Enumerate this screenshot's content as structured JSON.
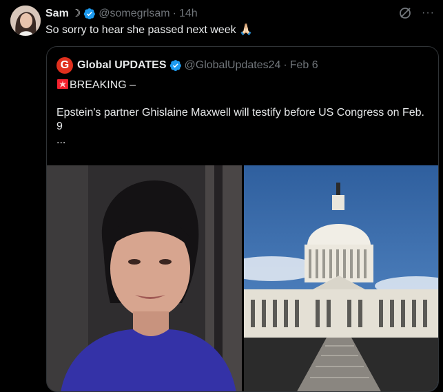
{
  "author": {
    "name": "Sam",
    "moon": "☽",
    "handle": "@somegrlsam",
    "separator": "·",
    "time": "14h"
  },
  "tweet": {
    "text": "So sorry to hear she passed next week",
    "emoji": "🙏🏻"
  },
  "header_icons": {
    "grok": "grok-icon",
    "more": "more-icon",
    "more_text": "···"
  },
  "quoted": {
    "logo_letter": "G",
    "name": "Global UPDATES",
    "handle": "@GlobalUpdates24",
    "separator": "·",
    "date": "Feb 6",
    "line1": "BREAKING –",
    "line2": "Epstein's partner Ghislaine Maxwell will testify before US Congress on Feb. 9",
    "line3": "..."
  },
  "colors": {
    "background": "#000000",
    "text": "#e7e9ea",
    "muted": "#71767b",
    "verified": "#1d9bf0",
    "border": "#2f3336",
    "logo_red": "#e0301e"
  },
  "images": [
    {
      "name": "portrait-photo"
    },
    {
      "name": "capitol-photo"
    }
  ]
}
